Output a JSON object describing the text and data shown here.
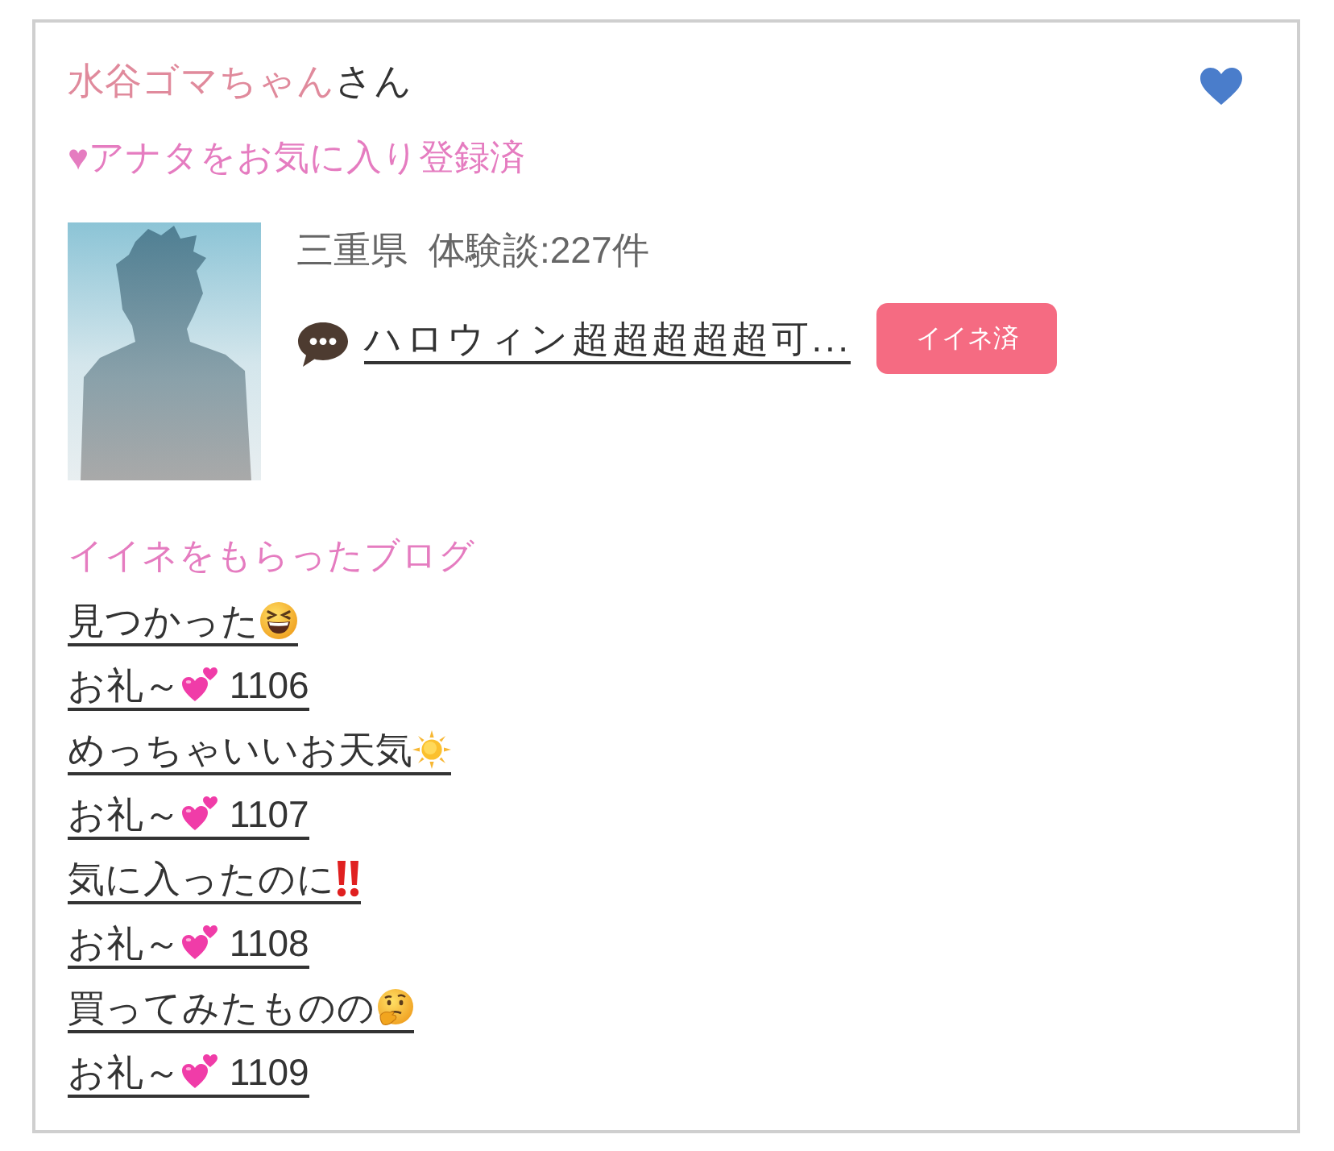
{
  "user": {
    "name": "水谷ゴマちゃん",
    "honorific": "さん"
  },
  "favorite_status": "♥アナタをお気に入り登録済",
  "profile": {
    "prefecture": "三重県",
    "reviews": "体験談:227件",
    "latest_post": "ハロウィン超超超超超可...",
    "like_button": "イイネ済"
  },
  "blog_section": {
    "title": "イイネをもらったブログ",
    "items": [
      {
        "title": "見つかった",
        "kind": "laugh"
      },
      {
        "title": "お礼～",
        "kind": "hearts",
        "suffix": "1106"
      },
      {
        "title": "めっちゃいいお天気",
        "kind": "sun"
      },
      {
        "title": "お礼～",
        "kind": "hearts",
        "suffix": "1107"
      },
      {
        "title": "気に入ったのに",
        "kind": "exclamation"
      },
      {
        "title": "お礼～",
        "kind": "hearts",
        "suffix": "1108"
      },
      {
        "title": "買ってみたものの",
        "kind": "thinking"
      },
      {
        "title": "お礼～",
        "kind": "hearts",
        "suffix": "1109"
      }
    ]
  }
}
